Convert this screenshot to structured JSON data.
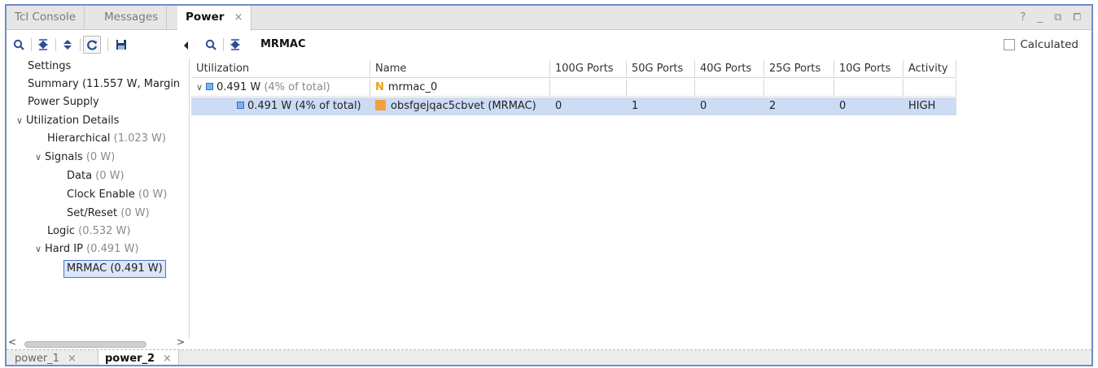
{
  "top_tabs": [
    {
      "label": "Tcl Console"
    },
    {
      "label": "Messages"
    },
    {
      "label": "Power",
      "close": "×"
    }
  ],
  "window_controls": "? _ ⧉ ⧠",
  "right_toolbar": {
    "title": "MRMAC",
    "calculated_label": "Calculated"
  },
  "tree": {
    "settings": "Settings",
    "summary": "Summary (11.557 W, Margin",
    "power_supply": "Power Supply",
    "utilization_details": "Utilization Details",
    "hierarchical": {
      "label": "Hierarchical",
      "value": "(1.023 W)"
    },
    "signals": {
      "label": "Signals",
      "value": "(0 W)"
    },
    "data": {
      "label": "Data",
      "value": "(0 W)"
    },
    "clock_enable": {
      "label": "Clock Enable",
      "value": "(0 W)"
    },
    "set_reset": {
      "label": "Set/Reset",
      "value": "(0 W)"
    },
    "logic": {
      "label": "Logic",
      "value": "(0.532 W)"
    },
    "hard_ip": {
      "label": "Hard IP",
      "value": "(0.491 W)"
    },
    "mrmac": "MRMAC (0.491 W)"
  },
  "table": {
    "headers": [
      "Utilization",
      "Name",
      "100G Ports",
      "50G Ports",
      "40G Ports",
      "25G Ports",
      "10G Ports",
      "Activity"
    ],
    "row1": {
      "util_value": "0.491 W",
      "util_pct": "(4% of total)",
      "name": "mrmac_0"
    },
    "row2": {
      "util_value": "0.491 W (4% of total)",
      "name": "obsfgejqac5cbvet (MRMAC)",
      "p100": "0",
      "p50": "1",
      "p40": "0",
      "p25": "2",
      "p10": "0",
      "activity": "HIGH"
    }
  },
  "bottom_tabs": [
    {
      "label": "power_1",
      "close": "×"
    },
    {
      "label": "power_2",
      "close": "×"
    }
  ],
  "colors": {
    "accent": "#6f8cc8",
    "selection": "#cddcf5",
    "muted": "#8a8a8a",
    "name_icon": "#f2a23c"
  }
}
